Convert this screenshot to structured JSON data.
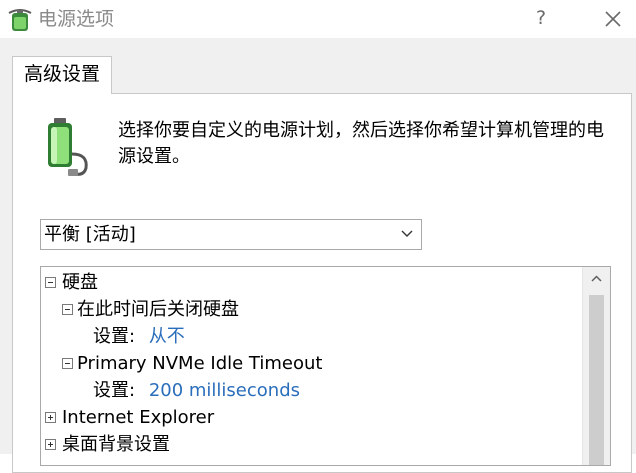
{
  "window": {
    "title": "电源选项",
    "help_label": "?",
    "close_icon": "close-icon",
    "app_icon": "power-options-icon"
  },
  "tab": {
    "label": "高级设置"
  },
  "description": "选择你要自定义的电源计划，然后选择你希望计算机管理的电源设置。",
  "plan_select": {
    "value": "平衡 [活动]",
    "icon": "chevron-down-icon"
  },
  "tree": {
    "hard_disk": {
      "label": "硬盘",
      "expanded": true
    },
    "turn_off_disk": {
      "label": "在此时间后关闭硬盘",
      "expanded": true
    },
    "turn_off_disk_setting": {
      "prefix": "设置:",
      "value": "从不"
    },
    "nvme_timeout": {
      "label": "Primary NVMe Idle Timeout",
      "expanded": true
    },
    "nvme_timeout_setting": {
      "prefix": "设置:",
      "value": "200 milliseconds"
    },
    "internet_explorer": {
      "label": "Internet Explorer",
      "expanded": false
    },
    "desktop_background": {
      "label": "桌面背景设置",
      "expanded": false
    }
  },
  "colors": {
    "accent_link": "#2a6ebb",
    "panel_bg": "#f0f0f0"
  }
}
